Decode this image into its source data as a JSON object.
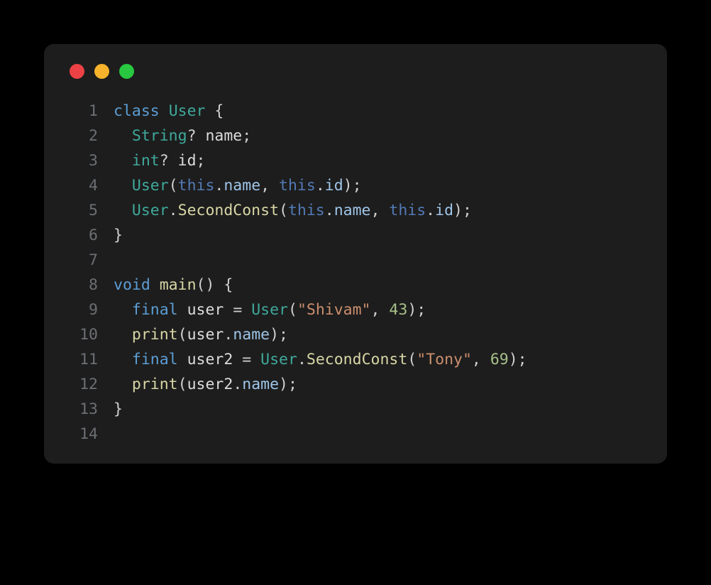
{
  "traffic_lights": {
    "red": "#ed4245",
    "yellow": "#f7b32b",
    "green": "#28c840"
  },
  "code": {
    "lines": [
      {
        "n": "1",
        "tokens": [
          [
            "kw",
            "class"
          ],
          [
            "",
            ""
          ],
          [
            "type",
            "User"
          ],
          [
            "",
            ""
          ],
          [
            "punc",
            "{"
          ]
        ]
      },
      {
        "n": "2",
        "tokens": [
          [
            "",
            "  "
          ],
          [
            "type",
            "String"
          ],
          [
            "punc",
            "?"
          ],
          [
            "",
            ""
          ],
          [
            "ident",
            "name"
          ],
          [
            "punc",
            ";"
          ]
        ]
      },
      {
        "n": "3",
        "tokens": [
          [
            "",
            "  "
          ],
          [
            "type",
            "int"
          ],
          [
            "punc",
            "?"
          ],
          [
            "",
            ""
          ],
          [
            "ident",
            "id"
          ],
          [
            "punc",
            ";"
          ]
        ]
      },
      {
        "n": "4",
        "tokens": [
          [
            "",
            "  "
          ],
          [
            "type",
            "User"
          ],
          [
            "punc",
            "("
          ],
          [
            "this",
            "this"
          ],
          [
            "punc",
            "."
          ],
          [
            "prop",
            "name"
          ],
          [
            "punc",
            ","
          ],
          [
            "",
            ""
          ],
          [
            "this",
            "this"
          ],
          [
            "punc",
            "."
          ],
          [
            "prop",
            "id"
          ],
          [
            "punc",
            ")"
          ],
          [
            "punc",
            ";"
          ]
        ]
      },
      {
        "n": "5",
        "tokens": [
          [
            "",
            "  "
          ],
          [
            "type",
            "User"
          ],
          [
            "punc",
            "."
          ],
          [
            "fn",
            "SecondConst"
          ],
          [
            "punc",
            "("
          ],
          [
            "this",
            "this"
          ],
          [
            "punc",
            "."
          ],
          [
            "prop",
            "name"
          ],
          [
            "punc",
            ","
          ],
          [
            "",
            ""
          ],
          [
            "this",
            "this"
          ],
          [
            "punc",
            "."
          ],
          [
            "prop",
            "id"
          ],
          [
            "punc",
            ")"
          ],
          [
            "punc",
            ";"
          ]
        ]
      },
      {
        "n": "6",
        "tokens": [
          [
            "punc",
            "}"
          ]
        ]
      },
      {
        "n": "7",
        "tokens": [
          [
            "",
            ""
          ]
        ]
      },
      {
        "n": "8",
        "tokens": [
          [
            "kw",
            "void"
          ],
          [
            "",
            ""
          ],
          [
            "fn",
            "main"
          ],
          [
            "punc",
            "("
          ],
          [
            "punc",
            ")"
          ],
          [
            "",
            ""
          ],
          [
            "punc",
            "{"
          ]
        ]
      },
      {
        "n": "9",
        "tokens": [
          [
            "",
            "  "
          ],
          [
            "kw",
            "final"
          ],
          [
            "",
            ""
          ],
          [
            "ident",
            "user"
          ],
          [
            "",
            ""
          ],
          [
            "op",
            "="
          ],
          [
            "",
            ""
          ],
          [
            "type",
            "User"
          ],
          [
            "punc",
            "("
          ],
          [
            "str",
            "\"Shivam\""
          ],
          [
            "punc",
            ","
          ],
          [
            "",
            ""
          ],
          [
            "num",
            "43"
          ],
          [
            "punc",
            ")"
          ],
          [
            "punc",
            ";"
          ]
        ]
      },
      {
        "n": "10",
        "tokens": [
          [
            "",
            "  "
          ],
          [
            "fn",
            "print"
          ],
          [
            "punc",
            "("
          ],
          [
            "ident",
            "user"
          ],
          [
            "punc",
            "."
          ],
          [
            "prop",
            "name"
          ],
          [
            "punc",
            ")"
          ],
          [
            "punc",
            ";"
          ]
        ]
      },
      {
        "n": "11",
        "tokens": [
          [
            "",
            "  "
          ],
          [
            "kw",
            "final"
          ],
          [
            "",
            ""
          ],
          [
            "ident",
            "user2"
          ],
          [
            "",
            ""
          ],
          [
            "op",
            "="
          ],
          [
            "",
            ""
          ],
          [
            "type",
            "User"
          ],
          [
            "punc",
            "."
          ],
          [
            "fn",
            "SecondConst"
          ],
          [
            "punc",
            "("
          ],
          [
            "str",
            "\"Tony\""
          ],
          [
            "punc",
            ","
          ],
          [
            "",
            ""
          ],
          [
            "num",
            "69"
          ],
          [
            "punc",
            ")"
          ],
          [
            "punc",
            ";"
          ]
        ]
      },
      {
        "n": "12",
        "tokens": [
          [
            "",
            "  "
          ],
          [
            "fn",
            "print"
          ],
          [
            "punc",
            "("
          ],
          [
            "ident",
            "user2"
          ],
          [
            "punc",
            "."
          ],
          [
            "prop",
            "name"
          ],
          [
            "punc",
            ")"
          ],
          [
            "punc",
            ";"
          ]
        ]
      },
      {
        "n": "13",
        "tokens": [
          [
            "punc",
            "}"
          ]
        ]
      },
      {
        "n": "14",
        "tokens": [
          [
            "",
            ""
          ]
        ]
      }
    ]
  }
}
